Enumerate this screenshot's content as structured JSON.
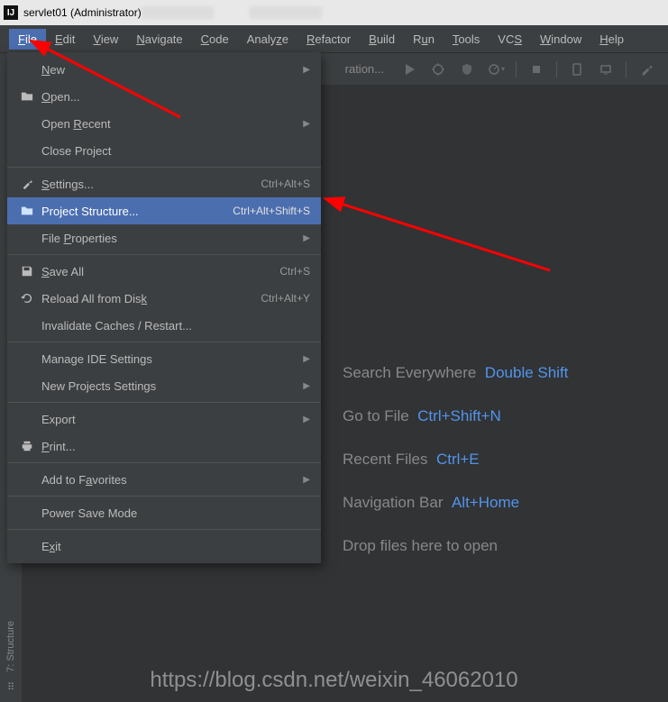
{
  "titlebar": {
    "project": "servlet01",
    "role": "(Administrator)"
  },
  "menubar": {
    "items": [
      {
        "pre": "",
        "u": "F",
        "post": "ile",
        "active": true
      },
      {
        "pre": "",
        "u": "E",
        "post": "dit"
      },
      {
        "pre": "",
        "u": "V",
        "post": "iew"
      },
      {
        "pre": "",
        "u": "N",
        "post": "avigate"
      },
      {
        "pre": "",
        "u": "C",
        "post": "ode"
      },
      {
        "pre": "Analy",
        "u": "z",
        "post": "e"
      },
      {
        "pre": "",
        "u": "R",
        "post": "efactor"
      },
      {
        "pre": "",
        "u": "B",
        "post": "uild"
      },
      {
        "pre": "R",
        "u": "u",
        "post": "n"
      },
      {
        "pre": "",
        "u": "T",
        "post": "ools"
      },
      {
        "pre": "VC",
        "u": "S",
        "post": ""
      },
      {
        "pre": "",
        "u": "W",
        "post": "indow"
      },
      {
        "pre": "",
        "u": "H",
        "post": "elp"
      }
    ]
  },
  "toolbar": {
    "config_tail": "ration..."
  },
  "dropdown": {
    "groups": [
      [
        {
          "icon": "",
          "pre": "",
          "u": "N",
          "post": "ew",
          "shortcut": "",
          "sub": true
        },
        {
          "icon": "folder",
          "pre": "",
          "u": "O",
          "post": "pen...",
          "shortcut": ""
        },
        {
          "icon": "",
          "pre": "Open ",
          "u": "R",
          "post": "ecent",
          "shortcut": "",
          "sub": true
        },
        {
          "icon": "",
          "pre": "Close Pro",
          "u": "j",
          "post": "ect",
          "shortcut": ""
        }
      ],
      [
        {
          "icon": "wrench",
          "pre": "",
          "u": "S",
          "post": "ettings...",
          "shortcut": "Ctrl+Alt+S"
        },
        {
          "icon": "project",
          "pre": "Project Stru",
          "u": "",
          "post": "cture...",
          "shortcut": "Ctrl+Alt+Shift+S",
          "selected": true
        },
        {
          "icon": "",
          "pre": "File ",
          "u": "P",
          "post": "roperties",
          "shortcut": "",
          "sub": true
        }
      ],
      [
        {
          "icon": "save",
          "pre": "",
          "u": "S",
          "post": "ave All",
          "shortcut": "Ctrl+S"
        },
        {
          "icon": "reload",
          "pre": "Reload All from Dis",
          "u": "k",
          "post": "",
          "shortcut": "Ctrl+Alt+Y"
        },
        {
          "icon": "",
          "pre": "Invalidate Caches / Restart...",
          "u": "",
          "post": "",
          "shortcut": ""
        }
      ],
      [
        {
          "icon": "",
          "pre": "Manage IDE Settings",
          "u": "",
          "post": "",
          "shortcut": "",
          "sub": true
        },
        {
          "icon": "",
          "pre": "New Projects Settings",
          "u": "",
          "post": "",
          "shortcut": "",
          "sub": true
        }
      ],
      [
        {
          "icon": "",
          "pre": "Export",
          "u": "",
          "post": "",
          "shortcut": "",
          "sub": true
        },
        {
          "icon": "print",
          "pre": "",
          "u": "P",
          "post": "rint...",
          "shortcut": ""
        }
      ],
      [
        {
          "icon": "",
          "pre": "Add to F",
          "u": "a",
          "post": "vorites",
          "shortcut": "",
          "sub": true
        }
      ],
      [
        {
          "icon": "",
          "pre": "Power Save Mode",
          "u": "",
          "post": "",
          "shortcut": ""
        }
      ],
      [
        {
          "icon": "",
          "pre": "E",
          "u": "x",
          "post": "it",
          "shortcut": ""
        }
      ]
    ]
  },
  "hints": [
    {
      "text": "Search Everywhere",
      "key": "Double Shift"
    },
    {
      "text": "Go to File",
      "key": "Ctrl+Shift+N"
    },
    {
      "text": "Recent Files",
      "key": "Ctrl+E"
    },
    {
      "text": "Navigation Bar",
      "key": "Alt+Home"
    },
    {
      "text": "Drop files here to open",
      "key": ""
    }
  ],
  "sidebar": {
    "structure": "7: Structure"
  },
  "watermark": "https://blog.csdn.net/weixin_46062010"
}
